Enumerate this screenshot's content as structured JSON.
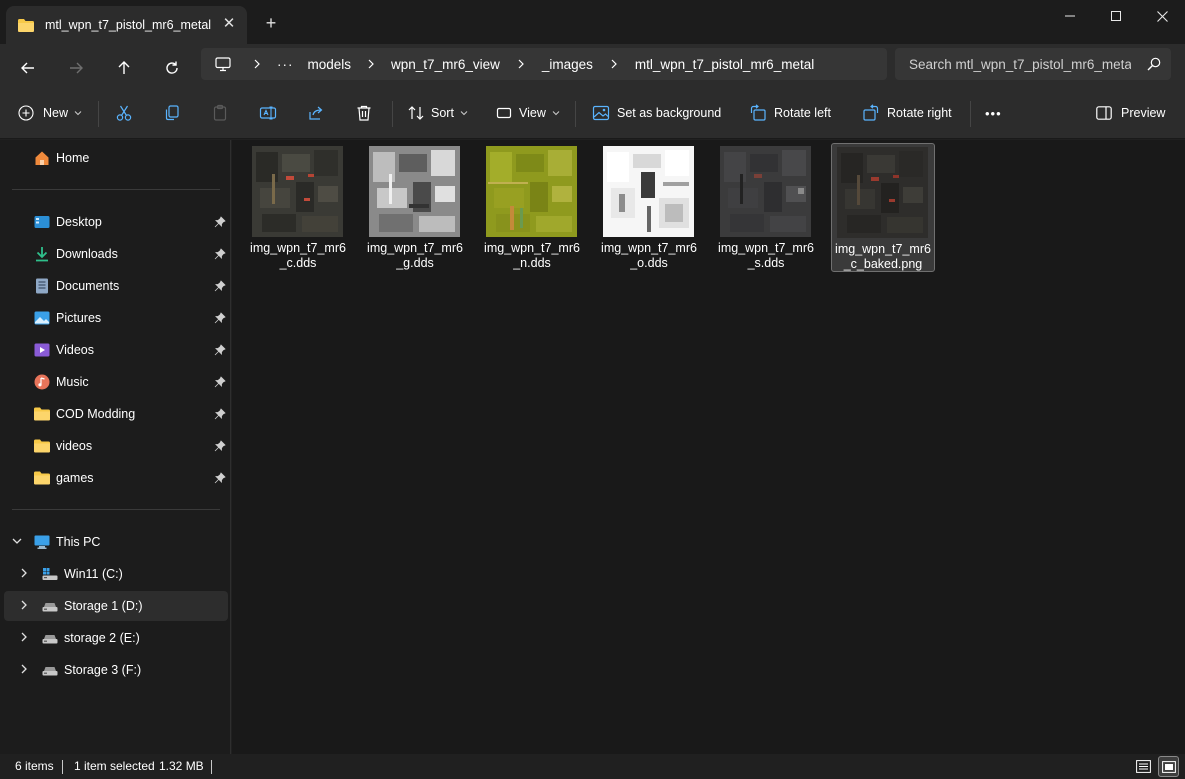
{
  "window": {
    "tab_title": "mtl_wpn_t7_pistol_mr6_metal",
    "tab_close": "✕",
    "new_tab": "+"
  },
  "address": {
    "more": "···",
    "crumbs": [
      "models",
      "wpn_t7_mr6_view",
      "_images",
      "mtl_wpn_t7_pistol_mr6_metal"
    ]
  },
  "search": {
    "placeholder": "Search mtl_wpn_t7_pistol_mr6_metal"
  },
  "toolbar": {
    "new": "New",
    "sort": "Sort",
    "view": "View",
    "set_background": "Set as background",
    "rotate_left": "Rotate left",
    "rotate_right": "Rotate right",
    "more": "•••",
    "preview": "Preview"
  },
  "sidebar": {
    "home": "Home",
    "quick_access": [
      {
        "label": "Desktop",
        "icon": "desktop-icon"
      },
      {
        "label": "Downloads",
        "icon": "downloads-icon"
      },
      {
        "label": "Documents",
        "icon": "documents-icon"
      },
      {
        "label": "Pictures",
        "icon": "pictures-icon"
      },
      {
        "label": "Videos",
        "icon": "videos-icon"
      },
      {
        "label": "Music",
        "icon": "music-icon"
      },
      {
        "label": "COD Modding",
        "icon": "folder-icon"
      },
      {
        "label": "videos",
        "icon": "folder-icon"
      },
      {
        "label": "games",
        "icon": "folder-icon"
      }
    ],
    "this_pc": "This PC",
    "drives": [
      {
        "label": "Win11 (C:)",
        "icon": "windows-drive-icon"
      },
      {
        "label": "Storage 1 (D:)",
        "icon": "drive-icon",
        "selected": true
      },
      {
        "label": "storage 2 (E:)",
        "icon": "drive-icon"
      },
      {
        "label": "Storage 3 (F:)",
        "icon": "drive-icon"
      }
    ]
  },
  "files": [
    {
      "line1": "img_wpn_t7_mr6",
      "line2": "_c.dds",
      "thumb": "color-map",
      "selected": false
    },
    {
      "line1": "img_wpn_t7_mr6",
      "line2": "_g.dds",
      "thumb": "gloss-map",
      "selected": false
    },
    {
      "line1": "img_wpn_t7_mr6",
      "line2": "_n.dds",
      "thumb": "normal-map",
      "selected": false
    },
    {
      "line1": "img_wpn_t7_mr6",
      "line2": "_o.dds",
      "thumb": "occlusion-map",
      "selected": false
    },
    {
      "line1": "img_wpn_t7_mr6",
      "line2": "_s.dds",
      "thumb": "specular-map",
      "selected": false
    },
    {
      "line1": "img_wpn_t7_mr6",
      "line2": "_c_baked.png",
      "thumb": "baked-map",
      "selected": true
    }
  ],
  "status": {
    "item_count": "6 items",
    "selection": "1 item selected",
    "size": "1.32 MB"
  },
  "colors": {
    "background": "#202020",
    "sidebar": "#1c1c1c",
    "content": "#191919",
    "accent": "#4cc2ff"
  }
}
